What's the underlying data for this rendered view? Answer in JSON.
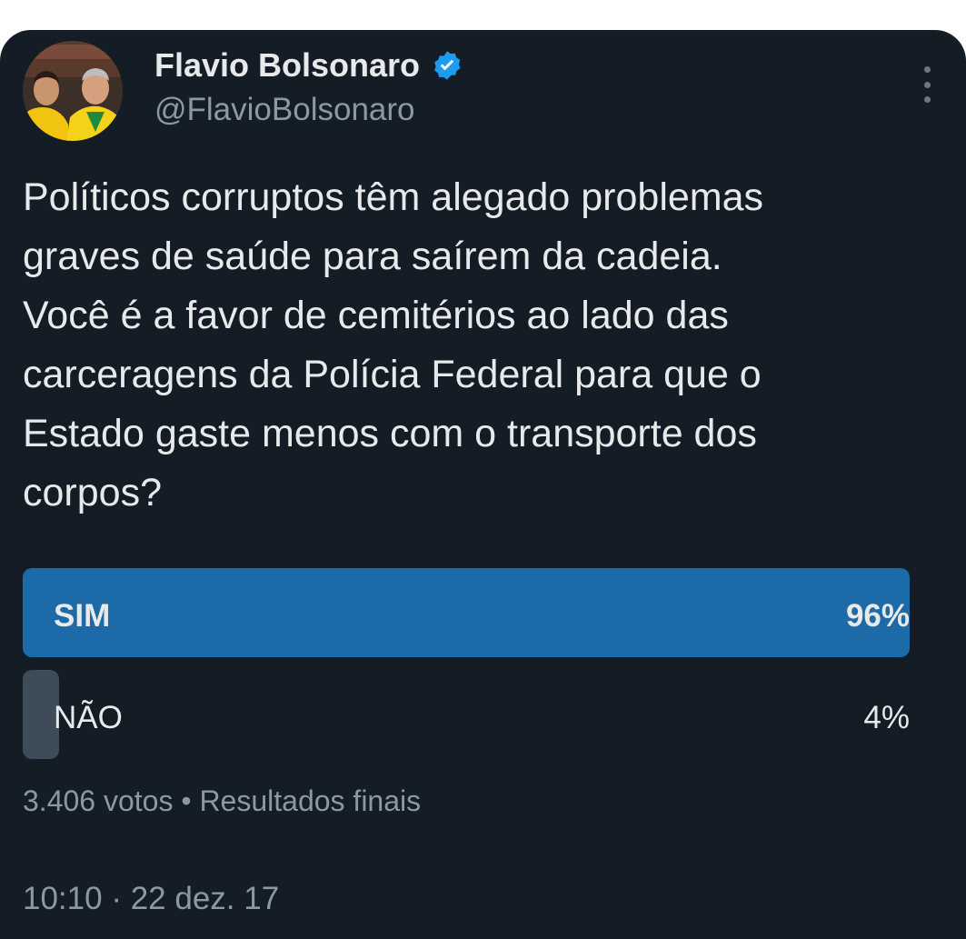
{
  "author": {
    "name": "Flavio Bolsonaro",
    "handle": "@FlavioBolsonaro",
    "verified_color": "#1d9bf0"
  },
  "icons": {
    "avatar": "profile-photo",
    "verified": "verified-badge-icon",
    "more": "more-options-icon"
  },
  "tweet": {
    "text": "Políticos corruptos têm alegado problemas\ngraves de saúde para saírem da cadeia.\nVocê é a favor de cemitérios ao lado das\ncarceragens da Polícia Federal para que o\nEstado gaste menos com o transporte dos\ncorpos?"
  },
  "poll": {
    "options": [
      {
        "label": "SIM",
        "percent_text": "96%",
        "percent": 96,
        "bar_color": "#1d6aa8",
        "winner": true
      },
      {
        "label": "NÃO",
        "percent_text": "4%",
        "percent": 4,
        "bar_color": "#3e4c59",
        "winner": false
      }
    ],
    "votes": "3.406 votos",
    "separator": "•",
    "status": "Resultados finais"
  },
  "timestamp": {
    "time": "10:10",
    "separator": "·",
    "date": "22 dez. 17"
  }
}
